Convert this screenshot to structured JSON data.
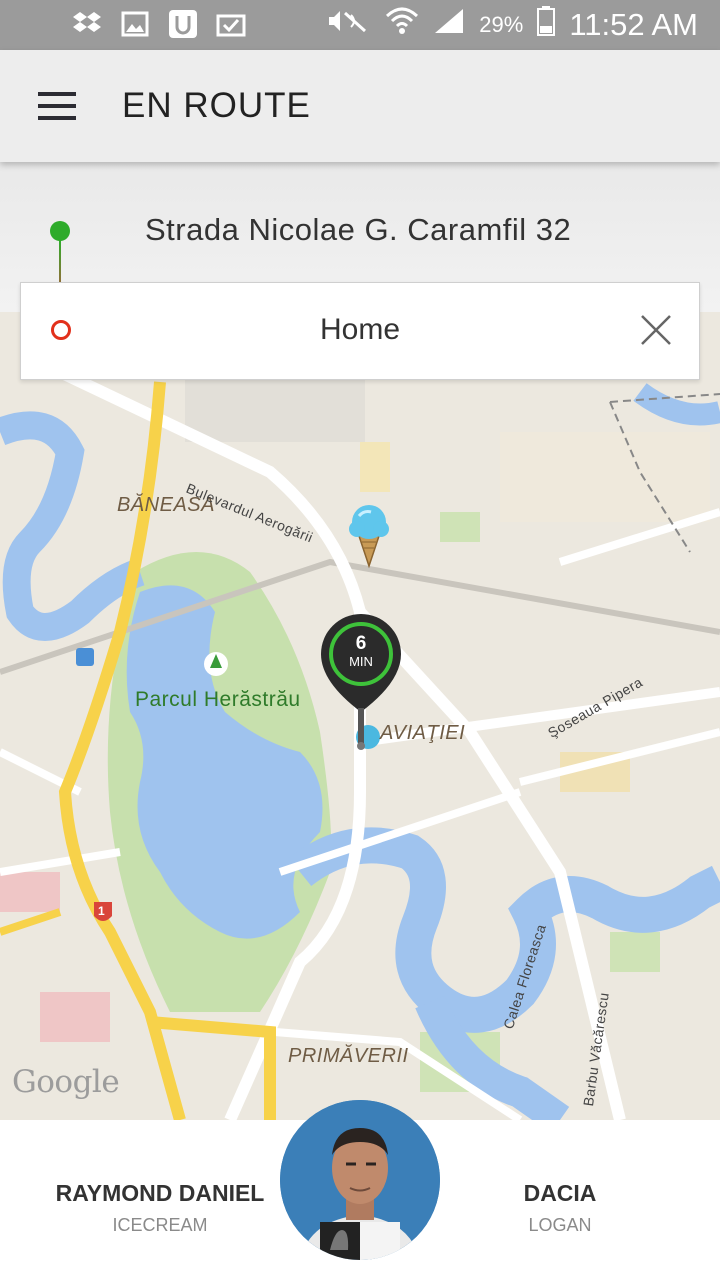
{
  "status_bar": {
    "battery_percent": "29%",
    "time": "11:52 AM",
    "icons": [
      "dropbox-icon",
      "gallery-icon",
      "uber-icon",
      "clipboard-check-icon",
      "mute-icon",
      "wifi-icon",
      "signal-icon",
      "battery-icon"
    ]
  },
  "app_bar": {
    "title": "EN ROUTE",
    "menu_icon": "hamburger-icon"
  },
  "route": {
    "pickup": "Strada Nicolae G. Caramfil 32",
    "destination": "Home",
    "pickup_color": "#2eab2a",
    "destination_color": "#e2301b"
  },
  "map": {
    "labels": {
      "baneasa": "BĂNEASA",
      "park": "Parcul Herăstrău",
      "aviatiei": "AVIAŢIEI",
      "primaverii": "PRIMĂVERII",
      "bulevard": "Bulevardul Aerogării",
      "pipera": "Şoseaua Pipera",
      "floreasca": "Calea Floreasca",
      "vacarescu": "Barbu Văcărescu"
    },
    "route_shield": "1",
    "eta": {
      "value": "6",
      "unit": "MIN"
    },
    "attribution": "Google"
  },
  "driver": {
    "name": "RAYMOND DANIEL",
    "subtitle": "ICECREAM",
    "car_make": "DACIA",
    "car_model": "LOGAN"
  }
}
